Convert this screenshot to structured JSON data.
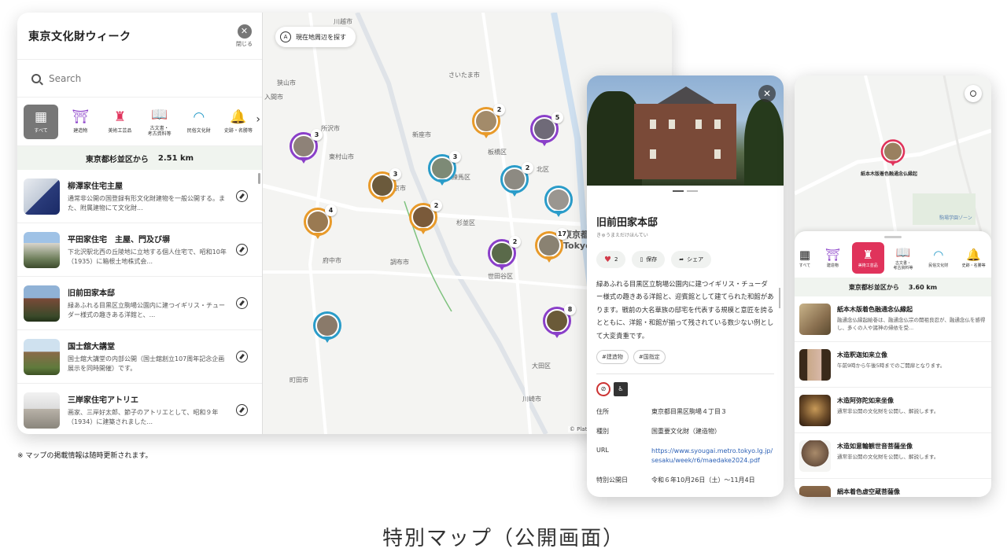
{
  "desktop": {
    "title": "東京文化財ウィーク",
    "close_label": "閉じる",
    "search_placeholder": "Search",
    "categories": [
      {
        "icon": "book-map-icon",
        "label": "すべて"
      },
      {
        "icon": "temple-icon",
        "label": "建造物"
      },
      {
        "icon": "craft-icon",
        "label": "美術工芸品"
      },
      {
        "icon": "book-open-icon",
        "label": "古文書・\n考古資料等"
      },
      {
        "icon": "fan-icon",
        "label": "民俗文化財"
      },
      {
        "icon": "bell-icon",
        "label": "史跡・名勝等"
      }
    ],
    "distance_from": "東京都杉並区から",
    "distance_value": "2.51 km",
    "items": [
      {
        "title": "柳澤家住宅主屋",
        "desc": "通常非公開の国登録有形文化財建物を一般公開する。また、附属建物にて文化財..."
      },
      {
        "title": "平田家住宅　主屋、門及び塀",
        "desc": "下北沢駅北西の丘陵地に立地する個人住宅で、昭和10年（1935）に箱根土地株式会..."
      },
      {
        "title": "旧前田家本邸",
        "desc": "緑あふれる目黒区立駒場公園内に建つイギリス・チューダー様式の趣きある洋館と、..."
      },
      {
        "title": "国士舘大講堂",
        "desc": "国士舘大講堂の内部公開（国士舘創立107周年記念企画展示を同時開催）です。"
      },
      {
        "title": "三岸家住宅アトリエ",
        "desc": "画家、三岸好太郎、節子のアトリエとして、昭和９年（1934）に建築されました..."
      }
    ],
    "map": {
      "nearby_button": "現在地周辺を探す",
      "attribution": "© Platinumaps | © MapTiler © Ope",
      "places": [
        "川越市",
        "狭山市",
        "入間市",
        "さいたま市",
        "所沢市",
        "新座市",
        "東村山市",
        "西東京市",
        "板橋区",
        "練馬区",
        "北区",
        "杉並区",
        "府中市",
        "調布市",
        "世田谷区",
        "東京都",
        "Tokyo",
        "大田区",
        "町田市",
        "川崎市",
        "区"
      ],
      "pin_counts": [
        "3",
        "2",
        "5",
        "3",
        "3",
        "2",
        "4",
        "2",
        "2",
        "17",
        "8"
      ]
    }
  },
  "note": "※ マップの掲載情報は随時更新されます。",
  "caption": "特別マップ（公開画面）",
  "detail": {
    "title": "旧前田家本邸",
    "ruby": "きゅうまえだけほんてい",
    "likes": "2",
    "save_label": "保存",
    "share_label": "シェア",
    "text": "緑あふれる目黒区立駒場公園内に建つイギリス・チューダー様式の趣きある洋館と、迎賓館として建てられた和館があります。戦前の大名華族の邸宅を代表する規模と意匠を誇るとともに、洋館・和館が揃って残されている数少ない例として大変貴重です。",
    "tags": [
      "#建造物",
      "#国指定"
    ],
    "rows": [
      {
        "key": "住所",
        "value": "東京都目黒区駒場４丁目３"
      },
      {
        "key": "種別",
        "value": "国重要文化財（建造物）"
      },
      {
        "key": "URL",
        "value": "https://www.syougai.metro.tokyo.lg.jp/sesaku/week/r6/maedake2024.pdf"
      },
      {
        "key": "特別公開日",
        "value": "令和６年10月26日（土）〜11月4日"
      }
    ]
  },
  "mobile": {
    "pin_label": "紙本木版着色融通念仏縁起",
    "park_label": "駒場学園ゾーン",
    "categories": [
      {
        "icon": "book-map-icon",
        "label": "すべて"
      },
      {
        "icon": "temple-icon",
        "label": "建造物"
      },
      {
        "icon": "craft-icon",
        "label": "美術工芸品"
      },
      {
        "icon": "book-open-icon",
        "label": "古文書・\n考古資料等"
      },
      {
        "icon": "fan-icon",
        "label": "民俗文化財"
      },
      {
        "icon": "bell-icon",
        "label": "史跡・名勝等"
      }
    ],
    "distance_from": "東京都杉並区から",
    "distance_value": "3.60 km",
    "items": [
      {
        "title": "紙本木版着色融通念仏縁起",
        "desc": "融通念仏縁起絵巻は、融通念仏宗の開祖良忍が、融通念仏を感得し、多くの人や諸神の帰依を受..."
      },
      {
        "title": "木造釈迦如来立像",
        "desc": "午前9時から午後5時までのご開扉となります。"
      },
      {
        "title": "木造阿弥陀如来坐像",
        "desc": "通常非公開の文化財を公開し、解説します。"
      },
      {
        "title": "木造如意輪観世音菩薩坐像",
        "desc": "通常非公開の文化財を公開し、解説します。"
      },
      {
        "title": "絹本着色虚空蔵菩薩像",
        "desc": ""
      }
    ]
  }
}
